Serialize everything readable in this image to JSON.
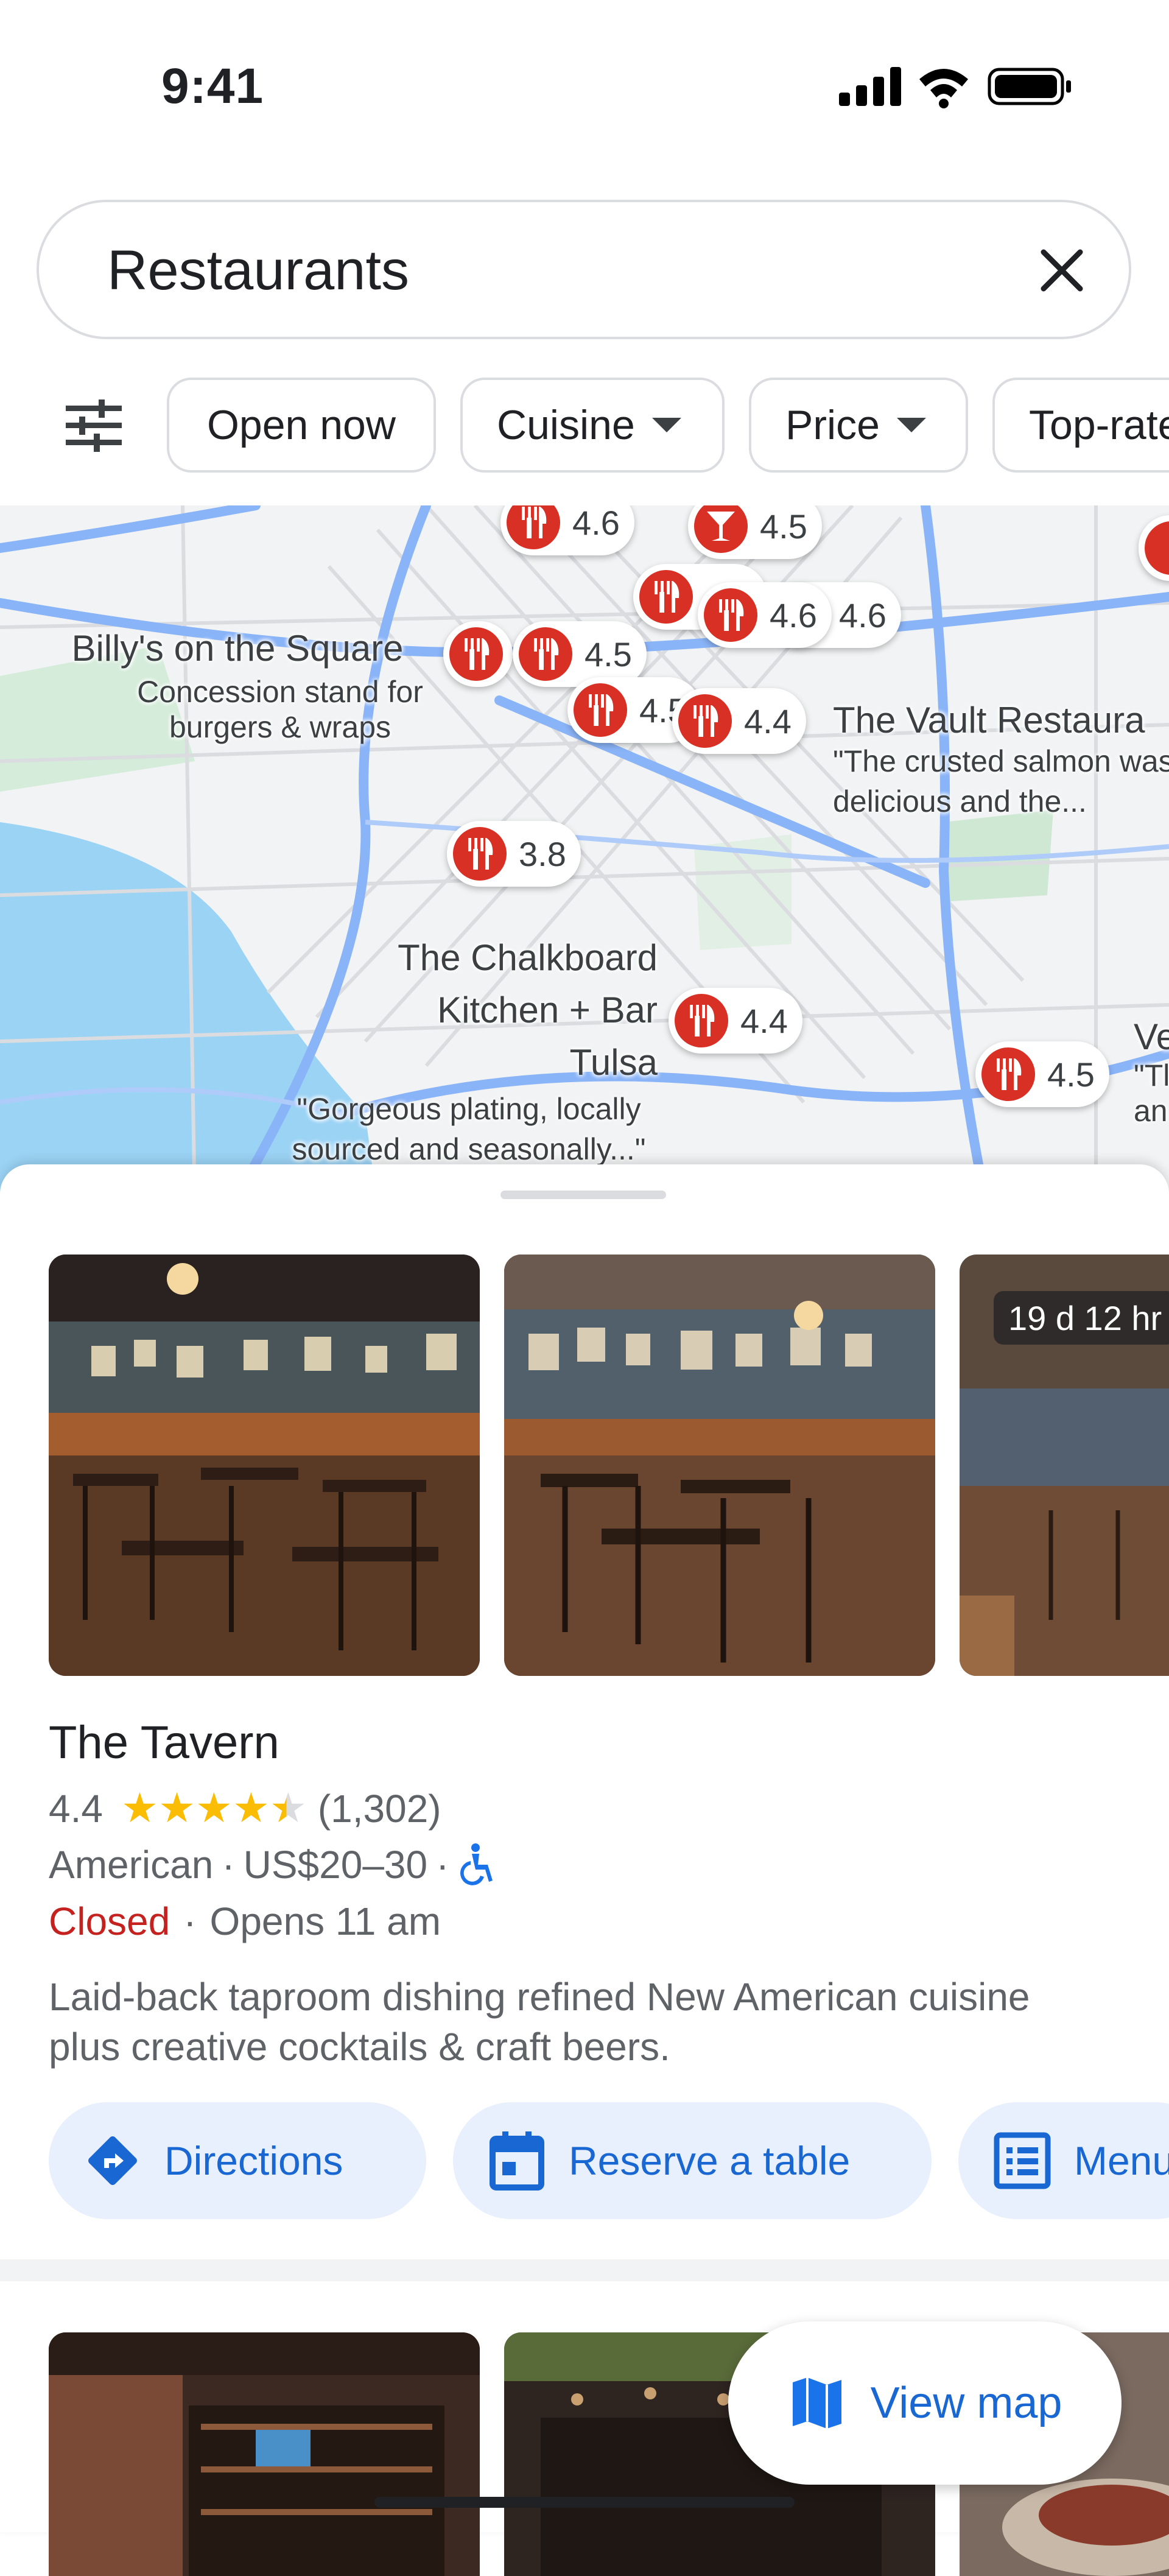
{
  "status_bar": {
    "time": "9:41"
  },
  "search": {
    "query": "Restaurants"
  },
  "filters": [
    "Open now",
    "Cuisine",
    "Price",
    "Top-rated"
  ],
  "map": {
    "pins": [
      {
        "rating": "4.6"
      },
      {
        "rating": "4.5"
      },
      {
        "rating": "4.6"
      },
      {
        "rating": "4.6"
      },
      {
        "rating": "4.5"
      },
      {
        "rating": "4.5"
      },
      {
        "rating": "4.4"
      },
      {
        "rating": "3.8"
      },
      {
        "rating": "4.4"
      },
      {
        "rating": "4.5"
      }
    ],
    "labels": {
      "billys": {
        "name": "Billy's on the Square",
        "desc": "Concession stand for burgers & wraps"
      },
      "vault": {
        "name": "The Vault Restaura",
        "desc": "\"The crusted salmon was delicious and the..."
      },
      "chalkboard": {
        "name": "The Chalkboard Kitchen + Bar Tulsa",
        "desc": "\"Gorgeous plating, locally sourced and seasonally...\""
      },
      "partial": {
        "name": "Ve",
        "desc": "\"Tl an"
      }
    }
  },
  "place": {
    "promo_badge": "19 d 12 hr",
    "name": "The Tavern",
    "rating": "4.4",
    "rating_value": 4.4,
    "review_count": "(1,302)",
    "cuisine": "American",
    "price": "US$20–30",
    "separator": "·",
    "status": "Closed",
    "opens": "Opens 11 am",
    "description": "Laid-back taproom dishing refined New American cuisine plus creative cocktails & craft beers.",
    "actions": [
      {
        "label": "Directions",
        "icon": "directions-icon"
      },
      {
        "label": "Reserve a table",
        "icon": "calendar-icon"
      },
      {
        "label": "Menu",
        "icon": "menu-list-icon"
      }
    ]
  },
  "view_map": {
    "label": "View map"
  },
  "colors": {
    "accent": "#1967d2",
    "pin": "#d93025",
    "closed": "#c5221f",
    "star": "#fbbc04"
  }
}
